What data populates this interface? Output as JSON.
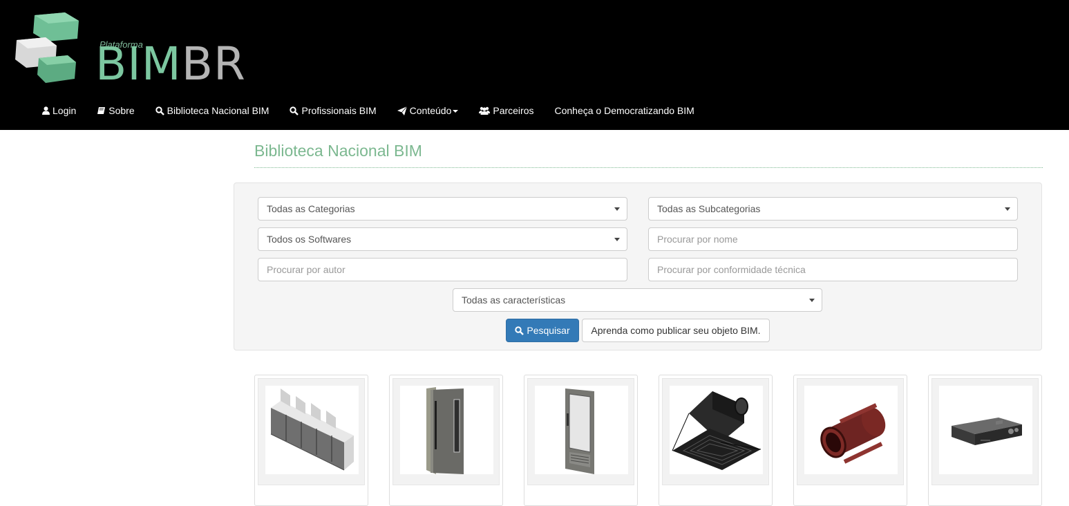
{
  "logo": {
    "small_text": "Plataforma",
    "big_text_bim": "BIM",
    "big_text_br": "BR"
  },
  "nav": [
    {
      "label": "Login",
      "icon": "user-icon"
    },
    {
      "label": "Sobre",
      "icon": "book-icon"
    },
    {
      "label": "Biblioteca Nacional BIM",
      "icon": "search-icon"
    },
    {
      "label": "Profissionais BIM",
      "icon": "search-icon"
    },
    {
      "label": "Conteúdo",
      "icon": "paper-plane-icon"
    },
    {
      "label": "Parceiros",
      "icon": "users-icon"
    },
    {
      "label": "Conheça o Democratizando BIM",
      "icon": ""
    }
  ],
  "page": {
    "title": "Biblioteca Nacional BIM"
  },
  "filters": {
    "categories": "Todas as Categorias",
    "subcategories": "Todas as Subcategorias",
    "softwares": "Todos os Softwares",
    "name_placeholder": "Procurar por nome",
    "author_placeholder": "Procurar por autor",
    "conformity_placeholder": "Procurar por conformidade técnica",
    "characteristics": "Todas as características"
  },
  "buttons": {
    "search": "Pesquisar",
    "learn": "Aprenda como publicar seu objeto BIM."
  },
  "products": [
    {
      "icon": "toilet-partitions-icon"
    },
    {
      "icon": "door-icon"
    },
    {
      "icon": "glass-door-icon"
    },
    {
      "icon": "ceiling-diffuser-icon"
    },
    {
      "icon": "pipe-fitting-icon"
    },
    {
      "icon": "amplifier-icon"
    }
  ],
  "colors": {
    "brand_green": "#7cc7a0",
    "primary_button": "#337ab7",
    "header_bg": "#000000"
  }
}
